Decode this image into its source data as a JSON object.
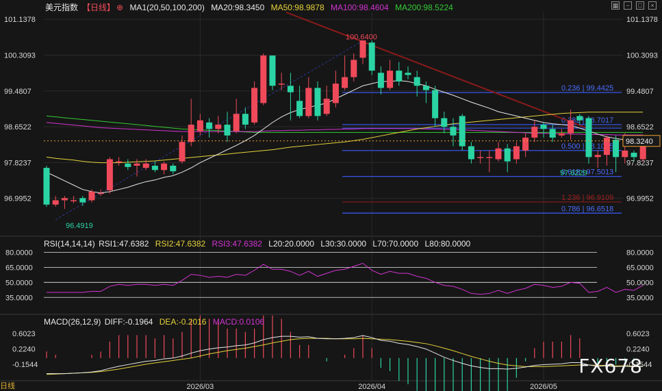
{
  "header": {
    "title": "美元指数",
    "period": "【日线】",
    "ma_label": "MA1(20,50,100,200)",
    "ma20": "MA20:98.3450",
    "ma50": "MA50:98.9878",
    "ma100": "MA100:98.4604",
    "ma200": "MA200:98.5224",
    "rsi_label": "RSI(14,14,14)",
    "rsi1": "RSI1:47.6382",
    "rsi2": "RSI2:47.6382",
    "rsi3": "RSI3:47.6382",
    "l20": "L20:20.0000",
    "l30": "L30:30.0000",
    "l70": "L70:70.0000",
    "l80": "L80:80.0000",
    "macd_label": "MACD(26,12,9)",
    "diff": "DIFF:-0.1964",
    "dea": "DEA:-0.2016",
    "macd": "MACD:0.0106"
  },
  "watermark": "FX678",
  "bottom_badge": "日线",
  "colors": {
    "up": "#f04a5a",
    "down": "#2bd4a4",
    "ma20": "#e8e8e8",
    "ma50": "#e6d33a",
    "ma100": "#d233d2",
    "ma200": "#33cc33",
    "fib": "#3a5bff",
    "trend": "#8b1a1a",
    "price_tag": "#f0a030"
  },
  "chart_data": {
    "type": "candlestick",
    "price_axis": [
      "101.1378",
      "100.3093",
      "99.4807",
      "98.6522",
      "97.8237",
      "96.9952"
    ],
    "price_ylim": [
      96.45,
      101.3
    ],
    "current_price": "98.3240",
    "high_label": "100.6400",
    "low_label": "96.4919",
    "low2_label": "97.6229",
    "x_labels": [
      {
        "i": 17,
        "label": "2026/03"
      },
      {
        "i": 36,
        "label": "2026/04"
      },
      {
        "i": 55,
        "label": "2026/05"
      }
    ],
    "candles": [
      [
        97.7,
        96.85,
        97.75,
        96.8
      ],
      [
        96.85,
        96.95,
        97.05,
        96.8
      ],
      [
        96.95,
        97.0,
        97.05,
        96.75
      ],
      [
        96.95,
        96.95,
        97.05,
        96.88
      ],
      [
        97.0,
        96.9,
        97.05,
        96.82
      ],
      [
        96.95,
        97.15,
        97.2,
        96.9
      ],
      [
        97.12,
        97.12,
        97.2,
        97.05
      ],
      [
        97.18,
        97.9,
        97.95,
        97.1
      ],
      [
        97.85,
        97.85,
        97.95,
        97.75
      ],
      [
        97.8,
        97.72,
        97.9,
        97.65
      ],
      [
        97.75,
        97.8,
        97.9,
        97.5
      ],
      [
        97.7,
        97.8,
        97.9,
        97.65
      ],
      [
        97.75,
        97.65,
        97.85,
        97.6
      ],
      [
        97.65,
        97.8,
        97.85,
        97.55
      ],
      [
        97.75,
        97.62,
        97.8,
        97.55
      ],
      [
        97.85,
        98.3,
        98.45,
        97.8
      ],
      [
        98.3,
        98.7,
        99.3,
        98.2
      ],
      [
        98.55,
        98.8,
        98.95,
        98.45
      ],
      [
        98.75,
        98.6,
        98.85,
        98.4
      ],
      [
        98.6,
        98.7,
        98.9,
        98.5
      ],
      [
        98.7,
        98.45,
        99.0,
        98.3
      ],
      [
        98.55,
        98.95,
        99.3,
        98.5
      ],
      [
        98.95,
        98.7,
        99.1,
        98.6
      ],
      [
        98.75,
        99.55,
        99.7,
        98.7
      ],
      [
        99.2,
        100.3,
        100.35,
        99.15
      ],
      [
        100.3,
        99.6,
        100.3,
        99.5
      ],
      [
        99.65,
        99.65,
        99.9,
        99.5
      ],
      [
        99.6,
        99.45,
        99.9,
        98.8
      ],
      [
        99.25,
        98.9,
        99.6,
        98.85
      ],
      [
        98.9,
        99.55,
        99.8,
        98.85
      ],
      [
        99.55,
        98.9,
        99.7,
        98.8
      ],
      [
        98.95,
        99.3,
        99.6,
        98.9
      ],
      [
        99.2,
        99.65,
        99.95,
        99.1
      ],
      [
        99.55,
        99.8,
        100.3,
        99.5
      ],
      [
        99.8,
        100.2,
        100.35,
        99.7
      ],
      [
        100.25,
        100.65,
        100.6,
        100.1
      ],
      [
        100.6,
        99.95,
        100.65,
        99.85
      ],
      [
        99.9,
        99.55,
        100.05,
        99.4
      ],
      [
        99.55,
        99.95,
        100.2,
        99.5
      ],
      [
        99.95,
        99.7,
        100.15,
        99.6
      ],
      [
        99.9,
        99.85,
        100.05,
        99.75
      ],
      [
        99.8,
        99.6,
        99.95,
        99.35
      ],
      [
        99.6,
        99.5,
        99.7,
        99.2
      ],
      [
        99.5,
        98.85,
        99.6,
        98.65
      ],
      [
        98.85,
        98.65,
        99.0,
        98.5
      ],
      [
        98.65,
        98.45,
        98.85,
        98.2
      ],
      [
        98.9,
        98.2,
        98.95,
        98.1
      ],
      [
        98.2,
        97.9,
        98.3,
        97.8
      ],
      [
        97.95,
        97.95,
        98.1,
        97.8
      ],
      [
        97.95,
        97.95,
        98.1,
        97.6
      ],
      [
        97.9,
        98.15,
        98.3,
        97.85
      ],
      [
        98.15,
        97.85,
        98.25,
        97.6
      ],
      [
        97.9,
        98.2,
        98.3,
        97.8
      ],
      [
        98.1,
        98.4,
        98.5,
        97.95
      ],
      [
        98.4,
        98.65,
        98.8,
        98.3
      ],
      [
        98.7,
        98.6,
        98.75,
        98.4
      ],
      [
        98.6,
        98.4,
        98.7,
        98.3
      ],
      [
        98.45,
        98.5,
        98.6,
        98.4
      ],
      [
        98.5,
        98.8,
        99.05,
        98.35
      ],
      [
        98.9,
        98.8,
        98.95,
        98.7
      ],
      [
        98.85,
        97.95,
        98.9,
        97.8
      ],
      [
        97.95,
        98.0,
        98.1,
        97.7
      ],
      [
        98.0,
        98.4,
        98.45,
        97.75
      ],
      [
        98.35,
        97.95,
        98.45,
        97.6
      ],
      [
        97.95,
        98.1,
        98.5,
        97.8
      ],
      [
        98.05,
        97.95,
        98.1,
        97.85
      ],
      [
        97.9,
        98.3,
        98.45,
        97.85
      ]
    ],
    "ma20": [
      97.6,
      97.5,
      97.4,
      97.3,
      97.2,
      97.15,
      97.12,
      97.15,
      97.2,
      97.25,
      97.32,
      97.38,
      97.42,
      97.48,
      97.52,
      97.6,
      97.7,
      97.82,
      97.92,
      98.02,
      98.12,
      98.22,
      98.33,
      98.45,
      98.6,
      98.75,
      98.88,
      98.98,
      99.05,
      99.1,
      99.15,
      99.2,
      99.3,
      99.4,
      99.5,
      99.6,
      99.65,
      99.7,
      99.7,
      99.72,
      99.7,
      99.65,
      99.6,
      99.52,
      99.45,
      99.38,
      99.3,
      99.22,
      99.15,
      99.08,
      99.0,
      98.95,
      98.9,
      98.85,
      98.8,
      98.75,
      98.72,
      98.7,
      98.68,
      98.62,
      98.55,
      98.48,
      98.42,
      98.38,
      98.35,
      98.34,
      98.34
    ],
    "ma50": [
      97.95,
      97.92,
      97.9,
      97.88,
      97.85,
      97.83,
      97.82,
      97.82,
      97.82,
      97.83,
      97.84,
      97.85,
      97.86,
      97.88,
      97.9,
      97.92,
      97.94,
      97.96,
      97.98,
      98.0,
      98.02,
      98.04,
      98.06,
      98.08,
      98.1,
      98.12,
      98.15,
      98.18,
      98.2,
      98.22,
      98.24,
      98.26,
      98.28,
      98.3,
      98.33,
      98.36,
      98.4,
      98.44,
      98.48,
      98.52,
      98.56,
      98.6,
      98.63,
      98.66,
      98.69,
      98.72,
      98.74,
      98.76,
      98.78,
      98.8,
      98.82,
      98.84,
      98.86,
      98.88,
      98.9,
      98.92,
      98.94,
      98.96,
      98.97,
      98.98,
      98.99,
      98.99,
      98.99,
      98.99,
      98.99,
      98.99,
      98.99
    ],
    "ma100": [
      98.75,
      98.73,
      98.71,
      98.69,
      98.67,
      98.65,
      98.63,
      98.62,
      98.61,
      98.6,
      98.59,
      98.58,
      98.57,
      98.56,
      98.55,
      98.54,
      98.54,
      98.54,
      98.54,
      98.54,
      98.54,
      98.54,
      98.54,
      98.54,
      98.55,
      98.56,
      98.56,
      98.57,
      98.57,
      98.58,
      98.58,
      98.59,
      98.59,
      98.6,
      98.6,
      98.61,
      98.61,
      98.61,
      98.61,
      98.61,
      98.61,
      98.61,
      98.6,
      98.6,
      98.59,
      98.59,
      98.58,
      98.57,
      98.56,
      98.55,
      98.54,
      98.53,
      98.52,
      98.51,
      98.5,
      98.5,
      98.49,
      98.49,
      98.48,
      98.48,
      98.47,
      98.47,
      98.47,
      98.46,
      98.46,
      98.46,
      98.46
    ],
    "ma200": [
      98.9,
      98.88,
      98.86,
      98.84,
      98.82,
      98.8,
      98.78,
      98.76,
      98.74,
      98.72,
      98.7,
      98.68,
      98.66,
      98.64,
      98.62,
      98.6,
      98.59,
      98.58,
      98.57,
      98.56,
      98.55,
      98.54,
      98.53,
      98.52,
      98.52,
      98.52,
      98.52,
      98.52,
      98.52,
      98.52,
      98.52,
      98.52,
      98.52,
      98.52,
      98.52,
      98.52,
      98.52,
      98.52,
      98.52,
      98.52,
      98.52,
      98.52,
      98.52,
      98.52,
      98.52,
      98.52,
      98.52,
      98.52,
      98.52,
      98.52,
      98.52,
      98.52,
      98.52,
      98.52,
      98.52,
      98.52,
      98.52,
      98.52,
      98.52,
      98.52,
      98.52,
      98.52,
      98.52,
      98.52,
      98.52,
      98.52,
      98.52
    ],
    "fib_levels": [
      {
        "label": "0.236 | 99.4425",
        "value": 99.4425,
        "color": "#3a5bff"
      },
      {
        "label": "0.382 | 98.7017",
        "value": 98.7017,
        "color": "#3a5bff"
      },
      {
        "label": "0.500 | 98.1015",
        "value": 98.1015,
        "color": "#3a5bff"
      },
      {
        "label": "0.618 | 97.5013",
        "value": 97.5013,
        "color": "#3a5bff"
      },
      {
        "label": "1.236 | 96.9109",
        "value": 96.9109,
        "color": "#8b1a1a"
      },
      {
        "label": "0.786 | 96.6518",
        "value": 96.6518,
        "color": "#3a5bff"
      }
    ],
    "rsi_axis": [
      "80.0000",
      "65.0000",
      "50.0000",
      "35.0000"
    ],
    "rsi_ylim": [
      27,
      83
    ],
    "rsi_values": [
      40,
      40,
      40,
      40,
      40,
      41,
      41,
      46,
      48,
      47,
      48,
      48,
      47,
      48,
      47,
      52,
      58,
      57,
      55,
      56,
      55,
      58,
      57,
      62,
      68,
      63,
      63,
      61,
      57,
      61,
      56,
      59,
      62,
      63,
      66,
      69,
      62,
      58,
      61,
      59,
      59,
      56,
      54,
      50,
      47,
      46,
      43,
      39,
      38,
      39,
      42,
      39,
      42,
      44,
      48,
      47,
      45,
      46,
      50,
      49,
      40,
      41,
      45,
      40,
      43,
      42,
      47
    ],
    "macd_axis": [
      "0.6023",
      "0.2240",
      "-0.1544"
    ],
    "macd_ylim": [
      -0.42,
      0.75
    ],
    "macd_diff": [
      -0.38,
      -0.38,
      -0.38,
      -0.37,
      -0.36,
      -0.34,
      -0.31,
      -0.25,
      -0.2,
      -0.16,
      -0.12,
      -0.08,
      -0.06,
      -0.02,
      0.0,
      0.05,
      0.12,
      0.18,
      0.22,
      0.25,
      0.27,
      0.3,
      0.32,
      0.37,
      0.45,
      0.5,
      0.53,
      0.53,
      0.51,
      0.52,
      0.48,
      0.47,
      0.47,
      0.48,
      0.5,
      0.55,
      0.5,
      0.43,
      0.41,
      0.36,
      0.33,
      0.28,
      0.22,
      0.12,
      0.02,
      -0.06,
      -0.13,
      -0.19,
      -0.23,
      -0.26,
      -0.26,
      -0.27,
      -0.25,
      -0.22,
      -0.18,
      -0.16,
      -0.15,
      -0.14,
      -0.11,
      -0.11,
      -0.17,
      -0.2,
      -0.19,
      -0.21,
      -0.2,
      -0.21,
      -0.2
    ],
    "macd_dea": [
      -0.4,
      -0.39,
      -0.38,
      -0.37,
      -0.36,
      -0.35,
      -0.33,
      -0.3,
      -0.27,
      -0.23,
      -0.19,
      -0.15,
      -0.12,
      -0.09,
      -0.06,
      -0.03,
      0.0,
      0.05,
      0.1,
      0.14,
      0.18,
      0.21,
      0.24,
      0.28,
      0.32,
      0.37,
      0.41,
      0.45,
      0.47,
      0.48,
      0.48,
      0.48,
      0.47,
      0.47,
      0.47,
      0.48,
      0.47,
      0.46,
      0.45,
      0.43,
      0.41,
      0.38,
      0.35,
      0.3,
      0.24,
      0.18,
      0.11,
      0.04,
      -0.02,
      -0.08,
      -0.13,
      -0.17,
      -0.19,
      -0.21,
      -0.21,
      -0.21,
      -0.2,
      -0.19,
      -0.18,
      -0.17,
      -0.17,
      -0.18,
      -0.18,
      -0.19,
      -0.19,
      -0.2,
      -0.2
    ]
  }
}
